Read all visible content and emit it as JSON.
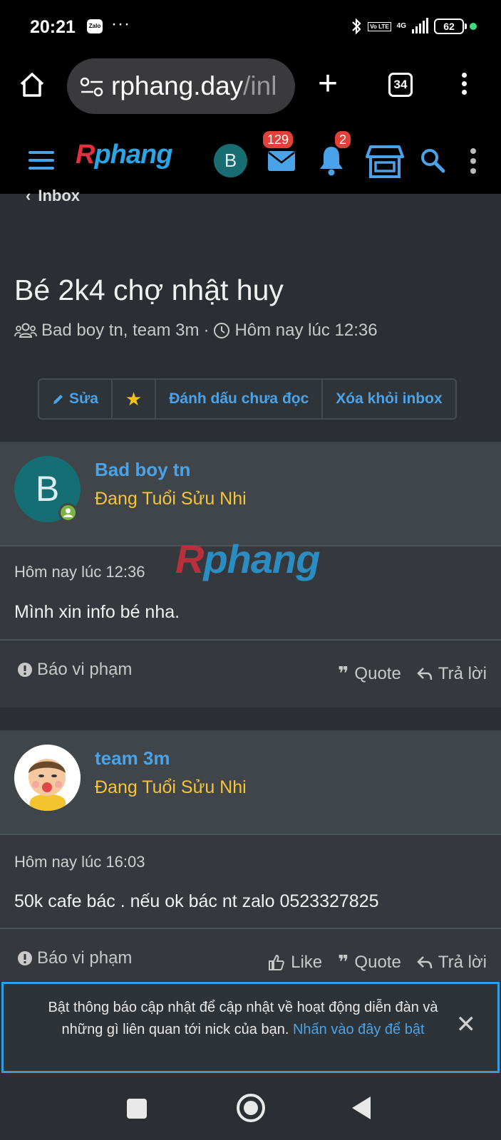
{
  "status_bar": {
    "time": "20:21",
    "notification_app": "Zalo",
    "more": "···",
    "volte": "Vo LTE",
    "network": "4G",
    "battery": "62"
  },
  "browser": {
    "url_main": "rphang.day",
    "url_rest": "/inl",
    "tab_count": "34"
  },
  "site_header": {
    "logo_left": "R",
    "logo_right": "phang",
    "avatar_letter": "B",
    "messages_badge": "129",
    "alerts_badge": "2"
  },
  "breadcrumb": "Inbox",
  "conversation": {
    "title": "Bé 2k4 chợ nhật huy",
    "participants": "Bad boy tn, team 3m",
    "separator": "·",
    "started": "Hôm nay lúc 12:36"
  },
  "actions": {
    "edit": "Sửa",
    "star": "★",
    "mark_unread": "Đánh dấu chưa đọc",
    "leave": "Xóa khỏi inbox"
  },
  "messages": [
    {
      "user": "Bad boy tn",
      "avatar_letter": "B",
      "rank": "Đang Tuổi Sửu Nhi",
      "time": "Hôm nay lúc 12:36",
      "body": "Mình xin info bé nha.",
      "report": "Báo vi phạm",
      "quote": "Quote",
      "reply": "Trả lời"
    },
    {
      "user": "team 3m",
      "rank": "Đang Tuổi Sửu Nhi",
      "time": "Hôm nay lúc 16:03",
      "body": "50k cafe bác . nếu ok bác nt zalo 0523327825",
      "report": "Báo vi phạm",
      "like": "Like",
      "quote": "Quote",
      "reply": "Trả lời"
    }
  ],
  "watermark": {
    "left": "R",
    "right": "phang"
  },
  "notice": {
    "text": "Bật thông báo cập nhật để cập nhật về hoạt động diễn đàn và những gì liên quan tới nick của bạn.",
    "link": "Nhấn vào đây để bật",
    "close": "✕"
  },
  "colors": {
    "accent": "#4aa3e8",
    "rank": "#f6c33b",
    "badge": "#e2413a",
    "online": "#7cb342"
  }
}
